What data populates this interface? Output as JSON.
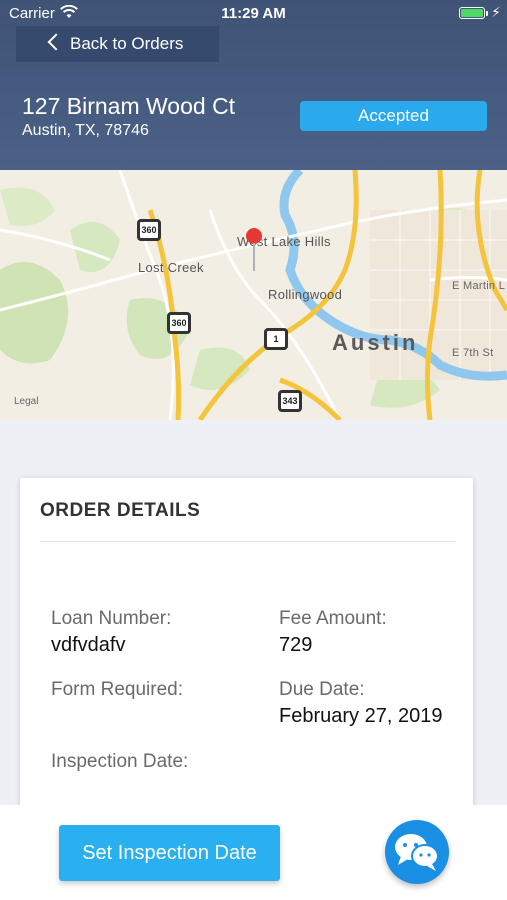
{
  "status_bar": {
    "carrier": "Carrier",
    "time": "11:29 AM"
  },
  "nav": {
    "back_label": "Back to Orders"
  },
  "property": {
    "street": "127 Birnam Wood Ct",
    "city_line": "Austin, TX, 78746",
    "status": "Accepted"
  },
  "map": {
    "labels": {
      "west_lake_hills": "West Lake Hills",
      "lost_creek": "Lost Creek",
      "rollingwood": "Rollingwood",
      "austin": "Austin",
      "e_martin": "E Martin L",
      "e_7th": "E 7th St"
    },
    "shields": {
      "hwy360_a": "360",
      "hwy360_b": "360",
      "hwy1": "1",
      "hwy343": "343"
    },
    "legal": "Legal"
  },
  "order_details": {
    "title": "ORDER DETAILS",
    "loan_number_label": "Loan Number:",
    "loan_number": "vdfvdafv",
    "fee_amount_label": "Fee Amount:",
    "fee_amount": "729",
    "form_required_label": "Form Required:",
    "due_date_label": "Due Date:",
    "due_date": "February 27, 2019",
    "inspection_date_label": "Inspection Date:"
  },
  "actions": {
    "set_inspection_label": "Set Inspection Date"
  },
  "colors": {
    "header": "#42577b",
    "accent": "#2ab0f0",
    "chat": "#1a8fe3"
  },
  "icons": {
    "back": "chevron-left-icon",
    "chat": "chat-bubbles-icon",
    "pin": "map-pin-icon"
  }
}
